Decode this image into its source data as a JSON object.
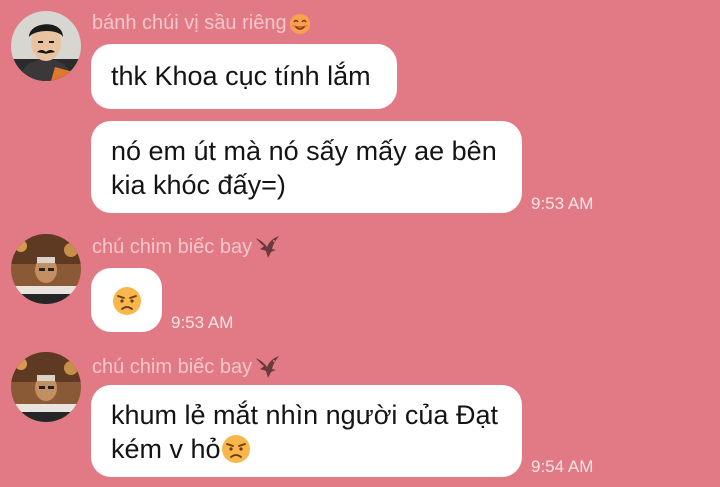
{
  "theme": {
    "background": "#e27a85",
    "bubble": "#ffffff",
    "sender_name_color": "#f5c6cb",
    "timestamp_color": "#fbe4e7",
    "text_color": "#141414"
  },
  "messages": [
    {
      "sender": "bánh chúi vị sầu riêng",
      "sender_emoji": "smiling-face-icon",
      "lines": [
        "thk Khoa cục tính lắm"
      ],
      "time": ""
    },
    {
      "sender": "",
      "lines": [
        "nó em út mà nó sấy mấy ae bên",
        "kia khóc đấy=)"
      ],
      "time": "9:53 AM"
    },
    {
      "sender": "chú chim biếc bay",
      "sender_emoji": "eagle-icon",
      "lines": [],
      "body_emoji": "disappointed-face-icon",
      "time": "9:53 AM"
    },
    {
      "sender": "chú chim biếc bay",
      "sender_emoji": "eagle-icon",
      "lines": [
        "khum lẻ mắt nhìn người của Đạt",
        "kém v hỏ"
      ],
      "trailing_emoji": "disappointed-face-icon",
      "time": "9:54 AM"
    }
  ]
}
